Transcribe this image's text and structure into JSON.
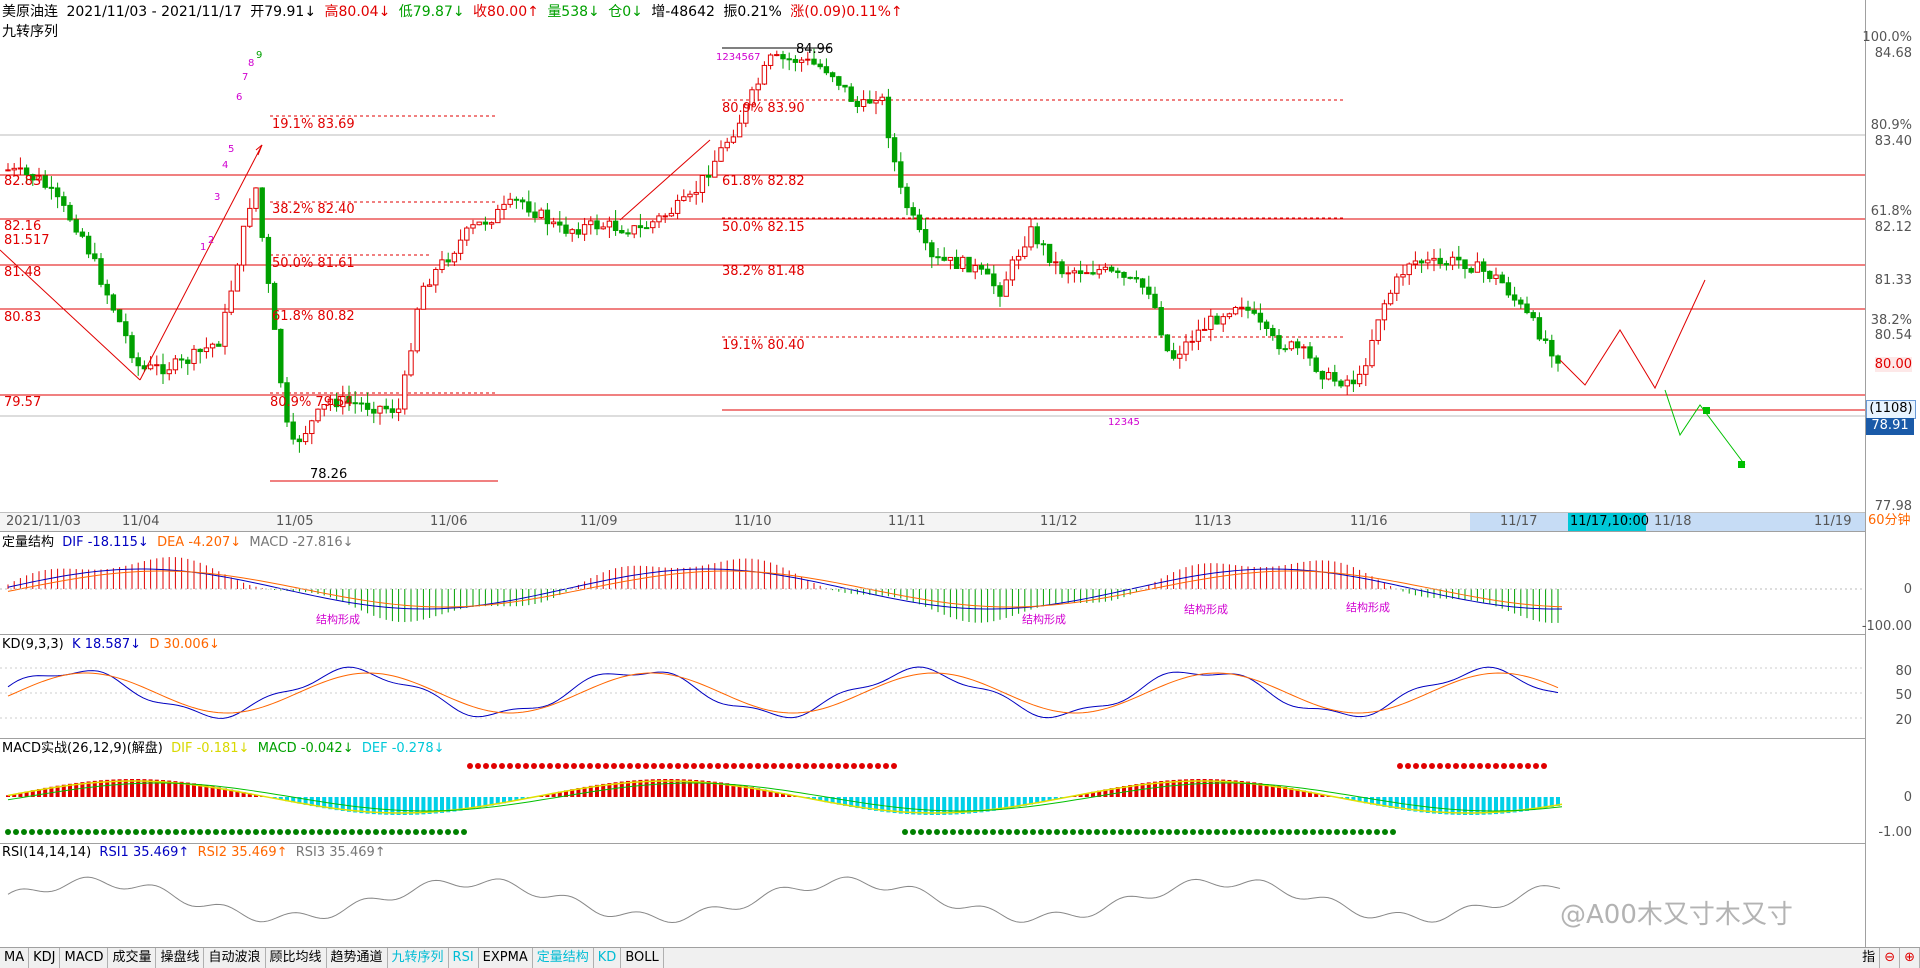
{
  "header": {
    "symbol": "美原油连",
    "range": "2021/11/03 - 2021/11/17",
    "open": "开79.91↓",
    "high": "高80.04↓",
    "low": "低79.87↓",
    "close": "收80.00↑",
    "volume": "量538↓",
    "position": "仓0↓",
    "increase": "增-48642",
    "amplitude": "振0.21%",
    "change": "涨(0.09)0.11%↑",
    "indicator": "九转序列"
  },
  "main_axis": [
    "100.0%",
    "84.68",
    "80.9%",
    "83.40",
    "61.8%",
    "82.12",
    "81.33",
    "38.2%",
    "80.54",
    "80.00",
    "(1108)",
    "78.91",
    "77.98"
  ],
  "fib_labels": [
    "19.1% 83.69",
    "38.2% 82.40",
    "50.0% 81.61",
    "61.8% 80.82",
    "80.9% 79.54",
    "80.9% 83.90",
    "61.8% 82.82",
    "50.0% 82.15",
    "38.2% 81.48",
    "19.1% 80.40"
  ],
  "price_marks": [
    "84.96",
    "78.26"
  ],
  "left_levels": [
    "82.83",
    "82.16",
    "81.517",
    "81.48",
    "80.83",
    "79.57"
  ],
  "dates": [
    "2021/11/03",
    "11/04",
    "11/05",
    "11/06",
    "11/09",
    "11/10",
    "11/11",
    "11/12",
    "11/13",
    "11/16",
    "11/17",
    "11/17,10:00",
    "11/18",
    "11/19",
    "60分钟"
  ],
  "seq_counts": {
    "up1": [
      "1",
      "2",
      "3",
      "4",
      "5",
      "6",
      "7",
      "8",
      "9"
    ],
    "top": "1234567",
    "bottom": "12345"
  },
  "panel_macd": {
    "title": "定量结构",
    "dif": "DIF -18.115↓",
    "dea": "DEA -4.207↓",
    "macd": "MACD -27.816↓",
    "axis": [
      "0",
      "-100.00"
    ],
    "tags": [
      "结构形成",
      "结构形成",
      "结构形成",
      "结构形成"
    ]
  },
  "panel_kd": {
    "title": "KD(9,3,3)",
    "k": "K 18.587↓",
    "d": "D 30.006↓",
    "axis": [
      "80",
      "50",
      "20"
    ]
  },
  "panel_macd2": {
    "title": "MACD实战(26,12,9)(解盘)",
    "dif": "DIF -0.181↓",
    "macd": "MACD -0.042↓",
    "def": "DEF -0.278↓",
    "axis": [
      "0",
      "-1.00"
    ]
  },
  "panel_rsi": {
    "title": "RSI(14,14,14)",
    "rsi1": "RSI1 35.469↑",
    "rsi2": "RSI2 35.469↑",
    "rsi3": "RSI3 35.469↑"
  },
  "watermark": "@A00木又寸木又寸",
  "tabs": [
    "MA",
    "KDJ",
    "MACD",
    "成交量",
    "操盘线",
    "自动波浪",
    "顾比均线",
    "趋势通道",
    "九转序列",
    "RSI",
    "EXPMA",
    "定量结构",
    "KD",
    "BOLL"
  ],
  "active_tabs": [
    "九转序列",
    "RSI",
    "定量结构",
    "KD"
  ],
  "corner": "指",
  "colors": {
    "up": "#e00000",
    "down": "#00a000",
    "fib": "#e00000",
    "highlight": "#00c8d8"
  }
}
